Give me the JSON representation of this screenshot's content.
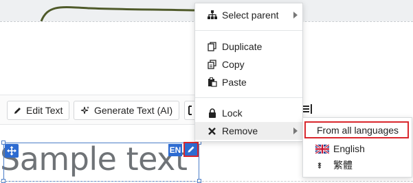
{
  "menu": {
    "items": [
      {
        "label": "Select parent",
        "icon": "hierarchy-icon",
        "has_submenu": true
      },
      {
        "label": "Duplicate",
        "icon": "duplicate-icon",
        "has_submenu": false
      },
      {
        "label": "Copy",
        "icon": "copy-icon",
        "has_submenu": false
      },
      {
        "label": "Paste",
        "icon": "paste-icon",
        "has_submenu": false
      },
      {
        "label": "Lock",
        "icon": "lock-icon",
        "has_submenu": false
      },
      {
        "label": "Remove",
        "icon": "close-icon",
        "has_submenu": true,
        "active": true
      }
    ]
  },
  "submenu": {
    "items": [
      {
        "label": "From all languages",
        "highlighted": true
      },
      {
        "label": "English",
        "icon": "uk-flag-icon"
      },
      {
        "label": "繁體",
        "icon": "language-glyph-icon"
      }
    ]
  },
  "toolbar": {
    "edit_label": "Edit Text",
    "generate_label": "Generate Text (AI)"
  },
  "canvas": {
    "sample_text": "Sample text",
    "language_badge": "EN"
  },
  "colors": {
    "selection": "#2d6bd1",
    "highlight": "#d9262c",
    "menu_hover": "#eeeeee"
  }
}
